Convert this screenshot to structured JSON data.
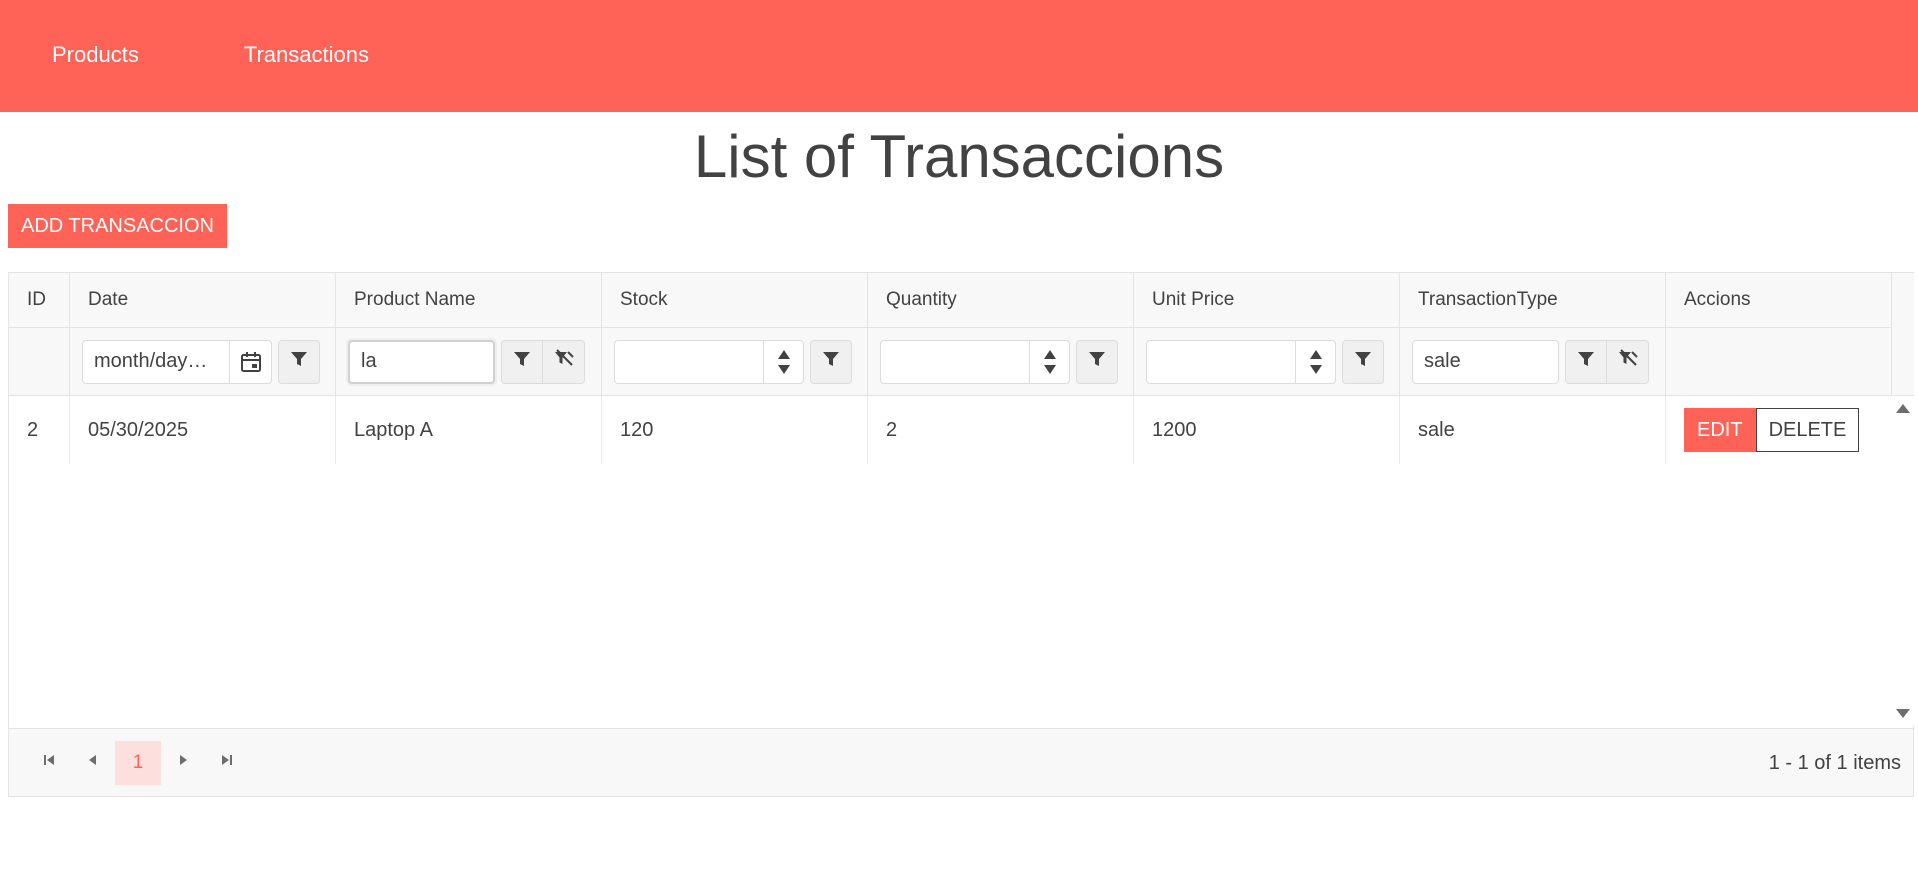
{
  "nav": {
    "items": [
      "Products",
      "Transactions"
    ]
  },
  "page": {
    "title": "List of Transaccions",
    "add_button": "ADD TRANSACCION"
  },
  "grid": {
    "columns": [
      "ID",
      "Date",
      "Product Name",
      "Stock",
      "Quantity",
      "Unit Price",
      "TransactionType",
      "Accions"
    ],
    "filters": {
      "date_placeholder": "month/day…",
      "product_name_value": "la",
      "stock_value": "",
      "quantity_value": "",
      "unit_price_value": "",
      "transaction_type_value": "sale"
    },
    "rows": [
      {
        "id": "2",
        "date": "05/30/2025",
        "product_name": "Laptop A",
        "stock": "120",
        "quantity": "2",
        "unit_price": "1200",
        "transaction_type": "sale",
        "edit": "EDIT",
        "delete": "DELETE"
      }
    ],
    "pager": {
      "current_page": "1",
      "info": "1 - 1 of 1 items"
    }
  },
  "colors": {
    "accent": "#ff6358",
    "header_bg": "#f8f8f8",
    "border": "#e4e4e4",
    "text": "#424242"
  },
  "icons": [
    "calendar-icon",
    "filter-icon",
    "filter-clear-icon",
    "spin-up-icon",
    "spin-down-icon",
    "first-page-icon",
    "prev-page-icon",
    "next-page-icon",
    "last-page-icon",
    "scroll-up-icon",
    "scroll-down-icon"
  ]
}
